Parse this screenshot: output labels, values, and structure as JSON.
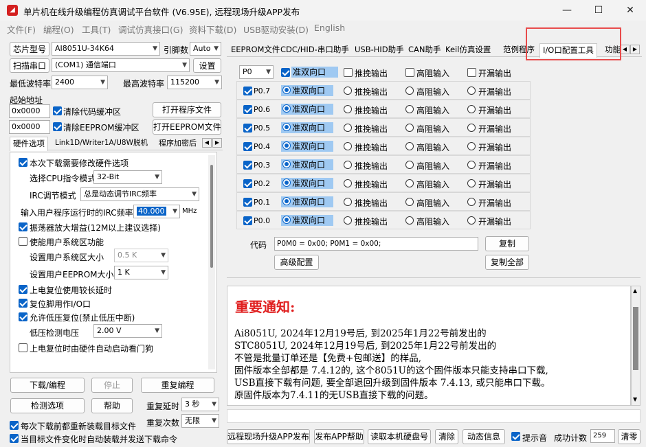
{
  "window": {
    "title": "单片机在线升级编程仿真调试平台软件 (V6.95E), 远程现场升级APP发布",
    "minimize": "—",
    "maximize": "☐",
    "close": "✕"
  },
  "menu": [
    "文件(F)",
    "编程(O)",
    "工具(T)",
    "调试仿真接口(G)",
    "资料下载(D)",
    "USB驱动安装(D)",
    "English"
  ],
  "left": {
    "chip_label": "芯片型号",
    "chip_value": "AI8051U-34K64",
    "pin_label": "引脚数",
    "pin_value": "Auto",
    "scan_button": "扫描串口",
    "port_value": "(COM1) 通信端口",
    "settings_button": "设置",
    "min_baud_label": "最低波特率",
    "min_baud_value": "2400",
    "max_baud_label": "最高波特率",
    "max_baud_value": "115200",
    "start_addr_label": "起始地址",
    "addr1_value": "0x0000",
    "clear_code_label": "清除代码缓冲区",
    "open_prog_button": "打开程序文件",
    "addr2_value": "0x0000",
    "clear_eeprom_label": "清除EEPROM缓冲区",
    "open_eeprom_button": "打开EEPROM文件",
    "tabs": [
      "硬件选项",
      "Link1D/Writer1A/U8W脱机",
      "程序加密后"
    ],
    "hw": {
      "modify_hw": "本次下载需要修改硬件选项",
      "cpu_mode_label": "选择CPU指令模式",
      "cpu_mode_value": "32-Bit",
      "irc_mode_label": "IRC调节模式",
      "irc_mode_value": "总是动态调节IRC频率",
      "irc_freq_label": "输入用户程序运行时的IRC频率",
      "irc_freq_value": "40.000",
      "irc_freq_unit": "MHz",
      "osc_gain": "振荡器放大增益(12M以上建议选择)",
      "user_sys": "使能用户系统区功能",
      "user_sys_size_label": "设置用户系统区大小",
      "user_sys_size_value": "0.5 K",
      "eeprom_size_label": "设置用户EEPROM大小",
      "eeprom_size_value": "1   K",
      "power_reset_delay": "上电复位使用较长延时",
      "reset_pin_io": "复位脚用作I/O口",
      "low_volt_reset": "允许低压复位(禁止低压中断)",
      "low_volt_label": "低压检测电压",
      "low_volt_value": "2.00 V",
      "watchdog": "上电复位时由硬件自动启动看门狗"
    },
    "download_button": "下载/编程",
    "stop_button": "停止",
    "reprogram_button": "重复编程",
    "detect_button": "检测选项",
    "help_button": "帮助",
    "repeat_delay_label": "重复延时",
    "repeat_delay_value": "3 秒",
    "repeat_count_label": "重复次数",
    "repeat_count_value": "无限",
    "reload_each": "每次下载前都重新装载目标文件",
    "auto_reload": "当目标文件变化时自动装载并发送下载命令"
  },
  "right": {
    "tabs": [
      "EEPROM文件",
      "CDC/HID-串口助手",
      "USB-HID助手",
      "CAN助手",
      "Keil仿真设置",
      "范例程序",
      "I/O口配置工具",
      "功能"
    ],
    "port_select": "P0",
    "header_options": [
      "准双向口",
      "推挽输出",
      "高阻输入",
      "开漏输出"
    ],
    "pins": [
      "P0.7",
      "P0.6",
      "P0.5",
      "P0.4",
      "P0.3",
      "P0.2",
      "P0.1",
      "P0.0"
    ],
    "code_label": "代码",
    "code_value": "P0M0 = 0x00; P0M1 = 0x00;",
    "copy_button": "复制",
    "advanced_button": "高级配置",
    "copy_all_button": "复制全部",
    "notice_title": "重要通知:",
    "notice_lines": [
      "Ai8051U, 2024年12月19号后, 到2025年1月22号前发出的",
      "STC8051U, 2024年12月19号后, 到2025年1月22号前发出的",
      "不管是批量订单还是【免费+包邮送】的样品,",
      "固件版本全部都是 7.4.12的, 这个8051U的这个固件版本只能支持串口下载,",
      "USB直接下载有问题, 要全部退回升级到固件版本 7.4.13, 或只能串口下载。",
      "原固件版本为7.4.11的无USB直接下载的问题。"
    ]
  },
  "bottom": {
    "remote_upgrade": "远程现场升级APP发布",
    "publish_help": "发布APP帮助",
    "read_disk": "读取本机硬盘号",
    "clear": "清除",
    "dynamic_info": "动态信息",
    "beep_label": "提示音",
    "success_label": "成功计数",
    "success_count": "259",
    "reset_count": "清零"
  },
  "colors": {
    "accent": "#0a64c8",
    "highlight": "#9fc9f2",
    "notice_red": "#e02020",
    "annotation_red": "#e84b4b"
  }
}
